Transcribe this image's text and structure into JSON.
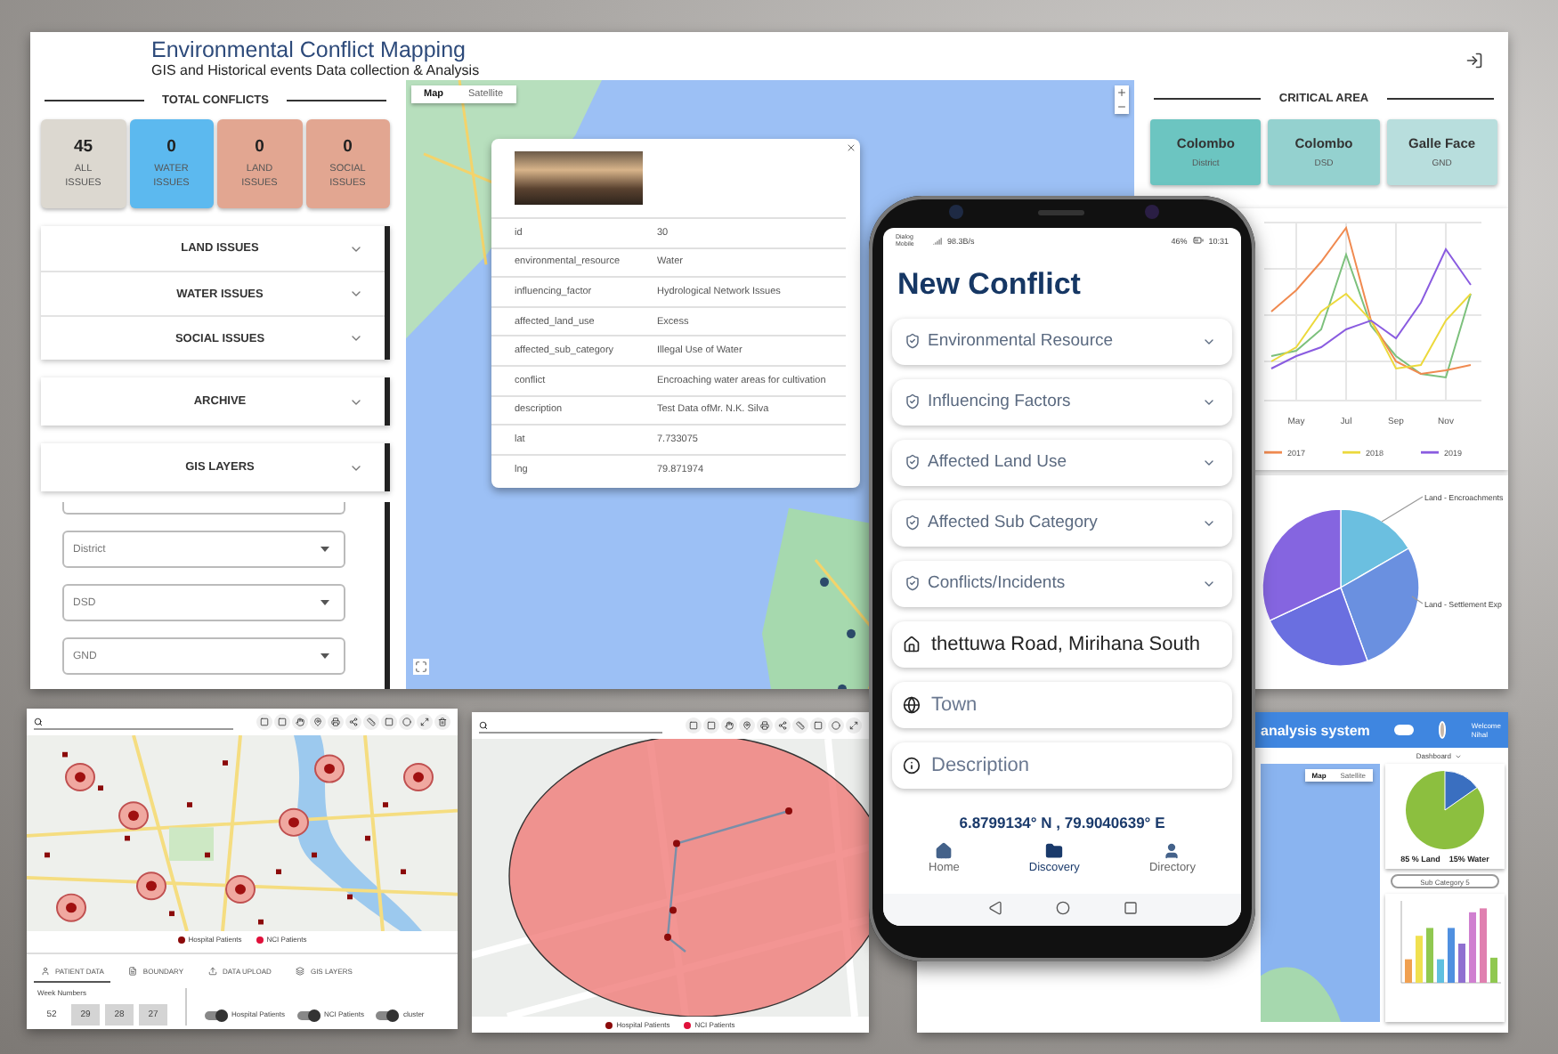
{
  "dashboard": {
    "title": "Environmental Conflict Mapping",
    "subtitle": "GIS and Historical events Data collection & Analysis",
    "total_conflicts": {
      "heading": "TOTAL CONFLICTS",
      "cards": [
        {
          "count": "45",
          "label": "ALL ISSUES",
          "color": "#dcd8d0"
        },
        {
          "count": "0",
          "label": "WATER ISSUES",
          "color": "#5cb9ef"
        },
        {
          "count": "0",
          "label": "LAND ISSUES",
          "color": "#e2a691"
        },
        {
          "count": "0",
          "label": "SOCIAL ISSUES",
          "color": "#e2a691"
        }
      ]
    },
    "accordion_groups": [
      {
        "items": [
          {
            "label": "LAND ISSUES",
            "expanded": false
          },
          {
            "label": "WATER ISSUES",
            "expanded": false
          },
          {
            "label": "SOCIAL ISSUES",
            "expanded": false
          }
        ]
      },
      {
        "items": [
          {
            "label": "ARCHIVE",
            "expanded": false
          }
        ]
      },
      {
        "items": [
          {
            "label": "GIS LAYERS",
            "expanded": false
          }
        ]
      }
    ],
    "filters": [
      {
        "placeholder": "District"
      },
      {
        "placeholder": "DSD"
      },
      {
        "placeholder": "GND"
      }
    ],
    "map": {
      "view_buttons": [
        {
          "label": "Map",
          "selected": true
        },
        {
          "label": "Satellite",
          "selected": false
        }
      ],
      "popup": {
        "rows": [
          {
            "key": "id",
            "value": "30"
          },
          {
            "key": "environmental_resource",
            "value": "Water"
          },
          {
            "key": "influencing_factor",
            "value": "Hydrological Network Issues"
          },
          {
            "key": "affected_land_use",
            "value": "Excess"
          },
          {
            "key": "affected_sub_category",
            "value": "Illegal Use of Water"
          },
          {
            "key": "conflict",
            "value": "Encroaching water areas for cultivation"
          },
          {
            "key": "description",
            "value": "Test Data ofMr. N.K. Silva"
          },
          {
            "key": "lat",
            "value": "7.733075"
          },
          {
            "key": "lng",
            "value": "79.871974"
          }
        ]
      }
    },
    "critical_area": {
      "heading": "CRITICAL AREA",
      "cards": [
        {
          "name": "Colombo",
          "area_type": "District",
          "color": "#6cc5c1"
        },
        {
          "name": "Colombo",
          "area_type": "DSD",
          "color": "#94d1cf"
        },
        {
          "name": "Galle Face",
          "area_type": "GND",
          "color": "#b8dedd"
        }
      ]
    },
    "line_chart": {
      "x_labels": [
        "May",
        "Jul",
        "Sep",
        "Nov"
      ],
      "legend": [
        {
          "label": "2017",
          "color": "#f08a50"
        },
        {
          "label": "2018",
          "color": "#ecd93c"
        },
        {
          "label": "2019",
          "color": "#8a5ce0"
        }
      ]
    },
    "pie_chart": {
      "labels": [
        "Land - Encroachments",
        "Land - Settlement Exp"
      ]
    }
  },
  "patient_map": {
    "legend": [
      {
        "label": "Hospital Patients",
        "color": "#8b0a0a"
      },
      {
        "label": "NCI Patients",
        "color": "#e0103a"
      }
    ],
    "tabs": [
      {
        "label": "PATIENT DATA",
        "selected": true
      },
      {
        "label": "BOUNDARY",
        "selected": false
      },
      {
        "label": "DATA UPLOAD",
        "selected": false
      },
      {
        "label": "GIS LAYERS",
        "selected": false
      }
    ],
    "week_heading": "Week Numbers",
    "weeks": [
      {
        "label": "52",
        "selected": false
      },
      {
        "label": "29",
        "selected": true
      },
      {
        "label": "28",
        "selected": true
      },
      {
        "label": "27",
        "selected": true
      }
    ],
    "toggles": [
      {
        "label": "Hospital Patients",
        "on": true
      },
      {
        "label": "NCI Patients",
        "on": true
      },
      {
        "label": "cluster",
        "on": true
      }
    ]
  },
  "radius_map": {
    "legend": [
      {
        "label": "Hospital Patients",
        "color": "#8b0a0a"
      },
      {
        "label": "NCI Patients",
        "color": "#e0103a"
      }
    ]
  },
  "analysis_dashboard": {
    "title": "analysis system",
    "user": "Welcome Nihal",
    "menu": "Dashboard",
    "map_buttons": [
      {
        "label": "Map",
        "selected": true
      },
      {
        "label": "Satellite",
        "selected": false
      }
    ],
    "pie_labels": [
      "85 % Land",
      "15% Water"
    ],
    "select": "Sub Category 5"
  },
  "phone": {
    "status": {
      "carrier": "Dialog Mobile",
      "speed": "98.3B/s",
      "battery": "46%",
      "time": "10:31"
    },
    "title": "New Conflict",
    "dropdowns": [
      "Environmental Resource",
      "Influencing Factors",
      "Affected Land Use",
      "Affected Sub Category",
      "Conflicts/Incidents"
    ],
    "fields": [
      {
        "kind": "address",
        "value": "thettuwa Road, Mirihana South"
      },
      {
        "kind": "town",
        "placeholder": "Town"
      },
      {
        "kind": "description",
        "placeholder": "Description"
      }
    ],
    "coordinates": "6.8799134° N , 79.9040639° E",
    "nav": [
      {
        "kind": "home",
        "label": "Home",
        "selected": false
      },
      {
        "kind": "discovery",
        "label": "Discovery",
        "selected": true
      },
      {
        "kind": "directory",
        "label": "Directory",
        "selected": false
      }
    ]
  }
}
